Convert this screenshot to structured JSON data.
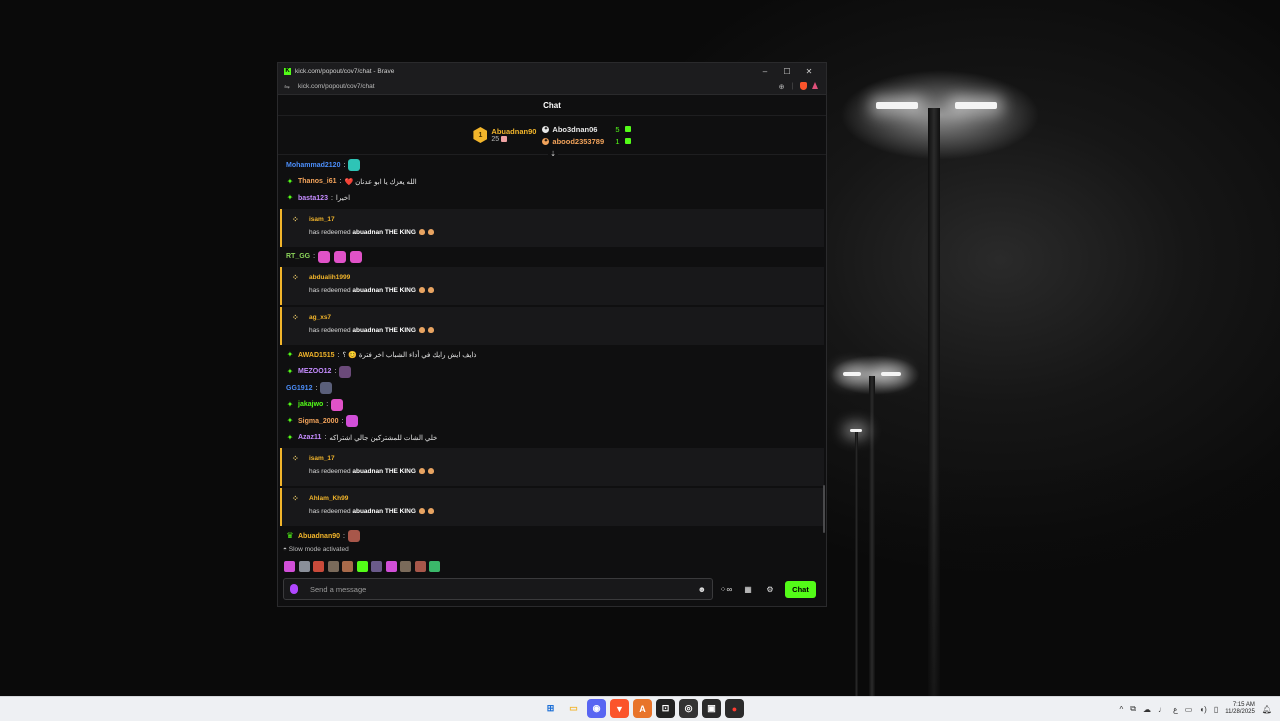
{
  "window": {
    "title": "kick.com/popout/cov7/chat - Brave",
    "url": "kick.com/popout/cov7/chat",
    "controls": {
      "minimize": "–",
      "maximize": "☐",
      "close": "✕"
    }
  },
  "chat": {
    "header": "Chat",
    "leaderboard": {
      "first": {
        "rank": "1",
        "name": "Abuadnan90",
        "count": "25"
      },
      "others": [
        {
          "name": "Abo3dnan06",
          "count": "5",
          "color": "#e8e8e8"
        },
        {
          "name": "abood2353789",
          "count": "1",
          "color": "#f2a35b"
        }
      ]
    },
    "messages": [
      {
        "type": "msg",
        "badge": "",
        "user": "Mohammad2120",
        "color": "#4b8df8",
        "text": "",
        "emotes": [
          "#2ec4b6"
        ]
      },
      {
        "type": "msg",
        "badge": "✦",
        "user": "Thanos_i61",
        "color": "#f2a35b",
        "text": "الله يعزك يا ابو عدنان ❤️",
        "emotes": []
      },
      {
        "type": "msg",
        "badge": "✦",
        "user": "basta123",
        "color": "#c58cff",
        "text": "اخيرا",
        "emotes": []
      },
      {
        "type": "redeem",
        "user": "isam_17",
        "pre": "has redeemed",
        "reward": "abuadnan THE KING"
      },
      {
        "type": "msg",
        "badge": "",
        "user": "RT_GG",
        "color": "#8bd45a",
        "text": "",
        "emotes": [
          "#e052c8",
          "#e052c8",
          "#e052c8"
        ]
      },
      {
        "type": "redeem",
        "user": "abdualih1999",
        "pre": "has redeemed",
        "reward": "abuadnan THE KING"
      },
      {
        "type": "redeem",
        "user": "ag_xs7",
        "pre": "has redeemed",
        "reward": "abuadnan THE KING"
      },
      {
        "type": "msg",
        "badge": "✦",
        "user": "AWAD1515",
        "color": "#f2b52b",
        "text": "ذايف ايش رايك في أداء الشباب اخر فترة 😊 ؟",
        "emotes": []
      },
      {
        "type": "msg",
        "badge": "✦",
        "user": "MEZOO12",
        "color": "#c58cff",
        "text": "",
        "emotes": [
          "#6b4a7a"
        ]
      },
      {
        "type": "msg",
        "badge": "",
        "user": "GG1912",
        "color": "#4b8df8",
        "text": "",
        "emotes": [
          "#5a5f7a"
        ]
      },
      {
        "type": "msg",
        "badge": "✦",
        "user": "jakajwo",
        "color": "#53fc18",
        "text": "",
        "emotes": [
          "#e052c8"
        ]
      },
      {
        "type": "msg",
        "badge": "✦",
        "user": "Sigma_2000",
        "color": "#f2a35b",
        "text": "",
        "emotes": [
          "#d14fd8"
        ]
      },
      {
        "type": "msg",
        "badge": "✦",
        "user": "Azaz11",
        "color": "#c58cff",
        "text": "خلي الشات للمشتركين جالي اشتراكه",
        "emotes": []
      },
      {
        "type": "redeem",
        "user": "isam_17",
        "pre": "has redeemed",
        "reward": "abuadnan THE KING"
      },
      {
        "type": "redeem",
        "user": "Ahlam_Kh99",
        "pre": "has redeemed",
        "reward": "abuadnan THE KING"
      },
      {
        "type": "msg",
        "badge": "♛",
        "user": "Abuadnan90",
        "color": "#f2b52b",
        "text": "",
        "emotes": [
          "#a8574a"
        ]
      }
    ],
    "slow_mode": "Slow mode activated",
    "emote_bar": [
      "#d14fd8",
      "#8a8f99",
      "#c94a3a",
      "#7a6a5a",
      "#a86a4a",
      "#53fc18",
      "#6a5a8a",
      "#d14fd8",
      "#7a6a5a",
      "#a8574a",
      "#3bb86a"
    ],
    "input": {
      "placeholder": "Send a message"
    },
    "send_label": "Chat"
  },
  "taskbar": {
    "apps": [
      {
        "name": "start",
        "glyph": "⊞",
        "color": "#1c6fd6",
        "bg": "transparent"
      },
      {
        "name": "file-explorer",
        "glyph": "▭",
        "color": "#f2b52b",
        "bg": "transparent"
      },
      {
        "name": "discord",
        "glyph": "◉",
        "color": "#ffffff",
        "bg": "#5865f2"
      },
      {
        "name": "brave",
        "glyph": "▼",
        "color": "#ffffff",
        "bg": "#fb542b"
      },
      {
        "name": "app-a",
        "glyph": "A",
        "color": "#ffffff",
        "bg": "#e8742a"
      },
      {
        "name": "app-dark",
        "glyph": "⊡",
        "color": "#ffffff",
        "bg": "#222222"
      },
      {
        "name": "obs",
        "glyph": "◎",
        "color": "#ffffff",
        "bg": "#333333"
      },
      {
        "name": "terminal",
        "glyph": "▣",
        "color": "#ffffff",
        "bg": "#2b2b2b"
      },
      {
        "name": "app-red",
        "glyph": "●",
        "color": "#ff3b30",
        "bg": "#2b2b2b"
      }
    ],
    "tray": {
      "arrow": "^",
      "lang": "ع",
      "time": "7:15 AM",
      "date": "11/28/2025"
    }
  }
}
